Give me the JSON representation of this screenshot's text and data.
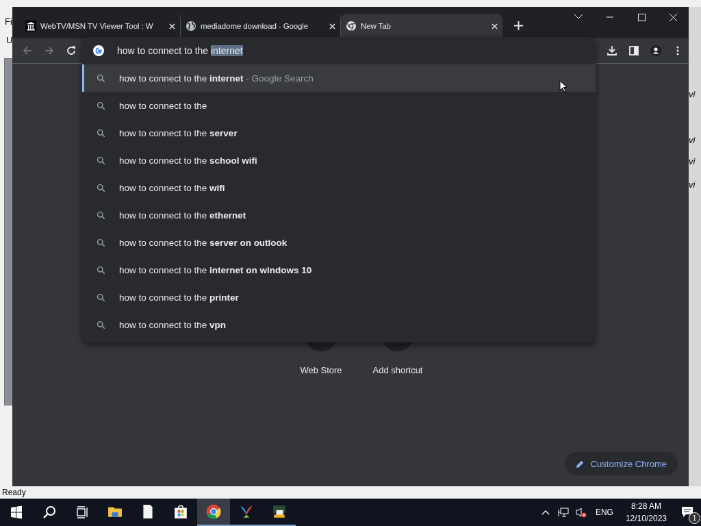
{
  "back_window": {
    "menu_fragment": "Fi",
    "toolbar_fragment": "U",
    "status": "Ready",
    "side_fragments": [
      "vi",
      "vi",
      "vi",
      "vi"
    ]
  },
  "tabs": [
    {
      "title": "WebTV/MSN TV Viewer Tool : W",
      "kind": "museum",
      "selected": false
    },
    {
      "title": "mediadome download - Google",
      "kind": "globe",
      "selected": false
    },
    {
      "title": "New Tab",
      "kind": "chrome",
      "selected": true
    }
  ],
  "omnibox": {
    "text": "how to connect to the ",
    "selected_text": "internet"
  },
  "suggestions": [
    {
      "text": "how to connect to the **internet**",
      "suffix": " - Google Search",
      "selected": true
    },
    {
      "text": "how to connect to the",
      "selected": false
    },
    {
      "text": "how to connect to the **server**",
      "selected": false
    },
    {
      "text": "how to connect to the **school wifi**",
      "selected": false
    },
    {
      "text": "how to connect to the **wifi**",
      "selected": false
    },
    {
      "text": "how to connect to the **ethernet**",
      "selected": false
    },
    {
      "text": "how to connect to the **server on outlook**",
      "selected": false
    },
    {
      "text": "how to connect to the **internet on windows 10**",
      "selected": false
    },
    {
      "text": "how to connect to the **printer**",
      "selected": false
    },
    {
      "text": "how to connect to the **vpn**",
      "selected": false
    }
  ],
  "shortcuts": [
    {
      "label": "Web Store"
    },
    {
      "label": "Add shortcut"
    }
  ],
  "customize_button": "Customize Chrome",
  "taskbar": {
    "apps": [
      {
        "kind": "explorer",
        "active": false
      },
      {
        "kind": "notepad",
        "active": false
      },
      {
        "kind": "store",
        "active": false
      },
      {
        "kind": "chrome",
        "active": true
      },
      {
        "kind": "msn",
        "active": false
      },
      {
        "kind": "viewer",
        "active": false
      }
    ],
    "language": "ENG",
    "time": "8:28 AM",
    "date": "12/10/2023",
    "notifications": "1"
  }
}
